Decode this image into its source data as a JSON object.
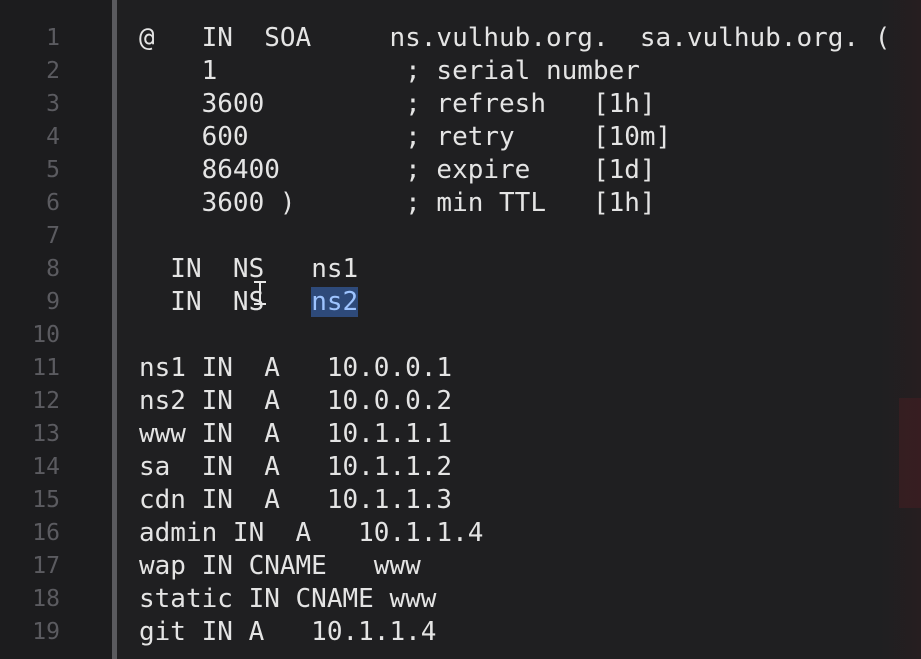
{
  "editor": {
    "lines": [
      {
        "num": "1",
        "text": "@   IN  SOA     ns.vulhub.org.  sa.vulhub.org. ("
      },
      {
        "num": "2",
        "text": "    1            ; serial number"
      },
      {
        "num": "3",
        "text": "    3600         ; refresh   [1h]"
      },
      {
        "num": "4",
        "text": "    600          ; retry     [10m]"
      },
      {
        "num": "5",
        "text": "    86400        ; expire    [1d]"
      },
      {
        "num": "6",
        "text": "    3600 )       ; min TTL   [1h]"
      },
      {
        "num": "7",
        "text": ""
      },
      {
        "num": "8",
        "text_before": "  IN  NS",
        "text_after": "   ns1"
      },
      {
        "num": "9",
        "text_before": "  IN  NS   ",
        "selected": "ns2"
      },
      {
        "num": "10",
        "text": ""
      },
      {
        "num": "11",
        "text": "ns1 IN  A   10.0.0.1"
      },
      {
        "num": "12",
        "text": "ns2 IN  A   10.0.0.2"
      },
      {
        "num": "13",
        "text": "www IN  A   10.1.1.1"
      },
      {
        "num": "14",
        "text": "sa  IN  A   10.1.1.2"
      },
      {
        "num": "15",
        "text": "cdn IN  A   10.1.1.3"
      },
      {
        "num": "16",
        "text": "admin IN  A   10.1.1.4"
      },
      {
        "num": "17",
        "text": "wap IN CNAME   www"
      },
      {
        "num": "18",
        "text": "static IN CNAME www"
      },
      {
        "num": "19",
        "text": "git IN A   10.1.1.4"
      }
    ]
  },
  "colors": {
    "background": "#1f1f21",
    "text": "#e4e4e4",
    "line_number": "#5b5b60",
    "selection": "#2e4a7a",
    "selection_text": "#9ec4ff"
  }
}
